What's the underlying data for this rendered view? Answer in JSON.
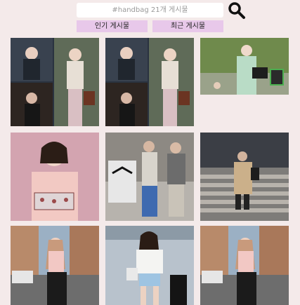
{
  "search": {
    "placeholder": "#handbag 21개 게시물"
  },
  "tabs": [
    {
      "label": "인기 게시물"
    },
    {
      "label": "최근 게시물"
    }
  ],
  "posts": [
    {
      "subject": "woman with brown handbag collage"
    },
    {
      "subject": "woman with brown handbag collage"
    },
    {
      "subject": "woman in mint coat with black bag"
    },
    {
      "subject": "woman in pink sweater with patterned bag"
    },
    {
      "subject": "couple in street fashion"
    },
    {
      "subject": "woman on stairs in trench coat"
    },
    {
      "subject": "woman with black bag on street"
    },
    {
      "subject": "woman in white jacket with suitcase"
    },
    {
      "subject": "woman with black bag on street"
    }
  ]
}
